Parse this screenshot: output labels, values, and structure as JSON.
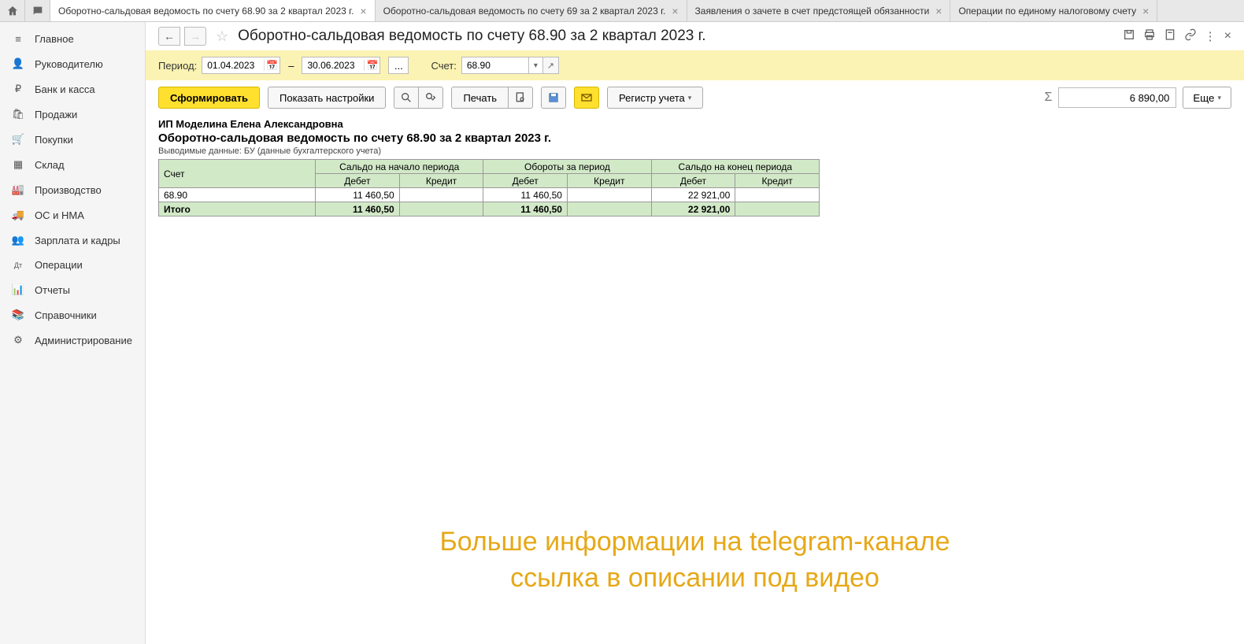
{
  "tabs": [
    {
      "label": "Оборотно-сальдовая ведомость по счету 68.90 за 2 квартал 2023 г.",
      "active": true
    },
    {
      "label": "Оборотно-сальдовая ведомость по счету 69 за 2 квартал 2023 г.",
      "active": false
    },
    {
      "label": "Заявления о зачете в счет предстоящей обязанности",
      "active": false
    },
    {
      "label": "Операции по единому налоговому счету",
      "active": false
    }
  ],
  "sidebar": {
    "items": [
      {
        "icon": "≡",
        "label": "Главное"
      },
      {
        "icon": "👤",
        "label": "Руководителю"
      },
      {
        "icon": "₽",
        "label": "Банк и касса"
      },
      {
        "icon": "🛍",
        "label": "Продажи"
      },
      {
        "icon": "🛒",
        "label": "Покупки"
      },
      {
        "icon": "▦",
        "label": "Склад"
      },
      {
        "icon": "🏭",
        "label": "Производство"
      },
      {
        "icon": "🚚",
        "label": "ОС и НМА"
      },
      {
        "icon": "👥",
        "label": "Зарплата и кадры"
      },
      {
        "icon": "Дт",
        "label": "Операции"
      },
      {
        "icon": "📊",
        "label": "Отчеты"
      },
      {
        "icon": "📚",
        "label": "Справочники"
      },
      {
        "icon": "⚙",
        "label": "Администрирование"
      }
    ]
  },
  "header": {
    "title": "Оборотно-сальдовая ведомость по счету 68.90 за 2 квартал 2023 г."
  },
  "filter": {
    "period_label": "Период:",
    "date_from": "01.04.2023",
    "date_to": "30.06.2023",
    "dash": "–",
    "dots": "...",
    "account_label": "Счет:",
    "account": "68.90"
  },
  "toolbar": {
    "form": "Сформировать",
    "settings": "Показать настройки",
    "print": "Печать",
    "register": "Регистр учета",
    "more": "Еще",
    "sum": "6 890,00"
  },
  "report": {
    "org": "ИП Моделина Елена Александровна",
    "title": "Оборотно-сальдовая ведомость по счету 68.90 за 2 квартал 2023 г.",
    "note": "Выводимые данные: БУ (данные бухгалтерского учета)",
    "headers": {
      "account": "Счет",
      "begin": "Сальдо на начало периода",
      "turnover": "Обороты за период",
      "end": "Сальдо на конец периода",
      "debit": "Дебет",
      "credit": "Кредит"
    },
    "rows": [
      {
        "acct": "68.90",
        "bd": "11 460,50",
        "bc": "",
        "td": "11 460,50",
        "tc": "",
        "ed": "22 921,00",
        "ec": ""
      }
    ],
    "total_label": "Итого",
    "totals": {
      "bd": "11 460,50",
      "bc": "",
      "td": "11 460,50",
      "tc": "",
      "ed": "22 921,00",
      "ec": ""
    }
  },
  "watermark": {
    "line1": "Больше информации на telegram-канале",
    "line2": "ссылка в описании под видео"
  }
}
